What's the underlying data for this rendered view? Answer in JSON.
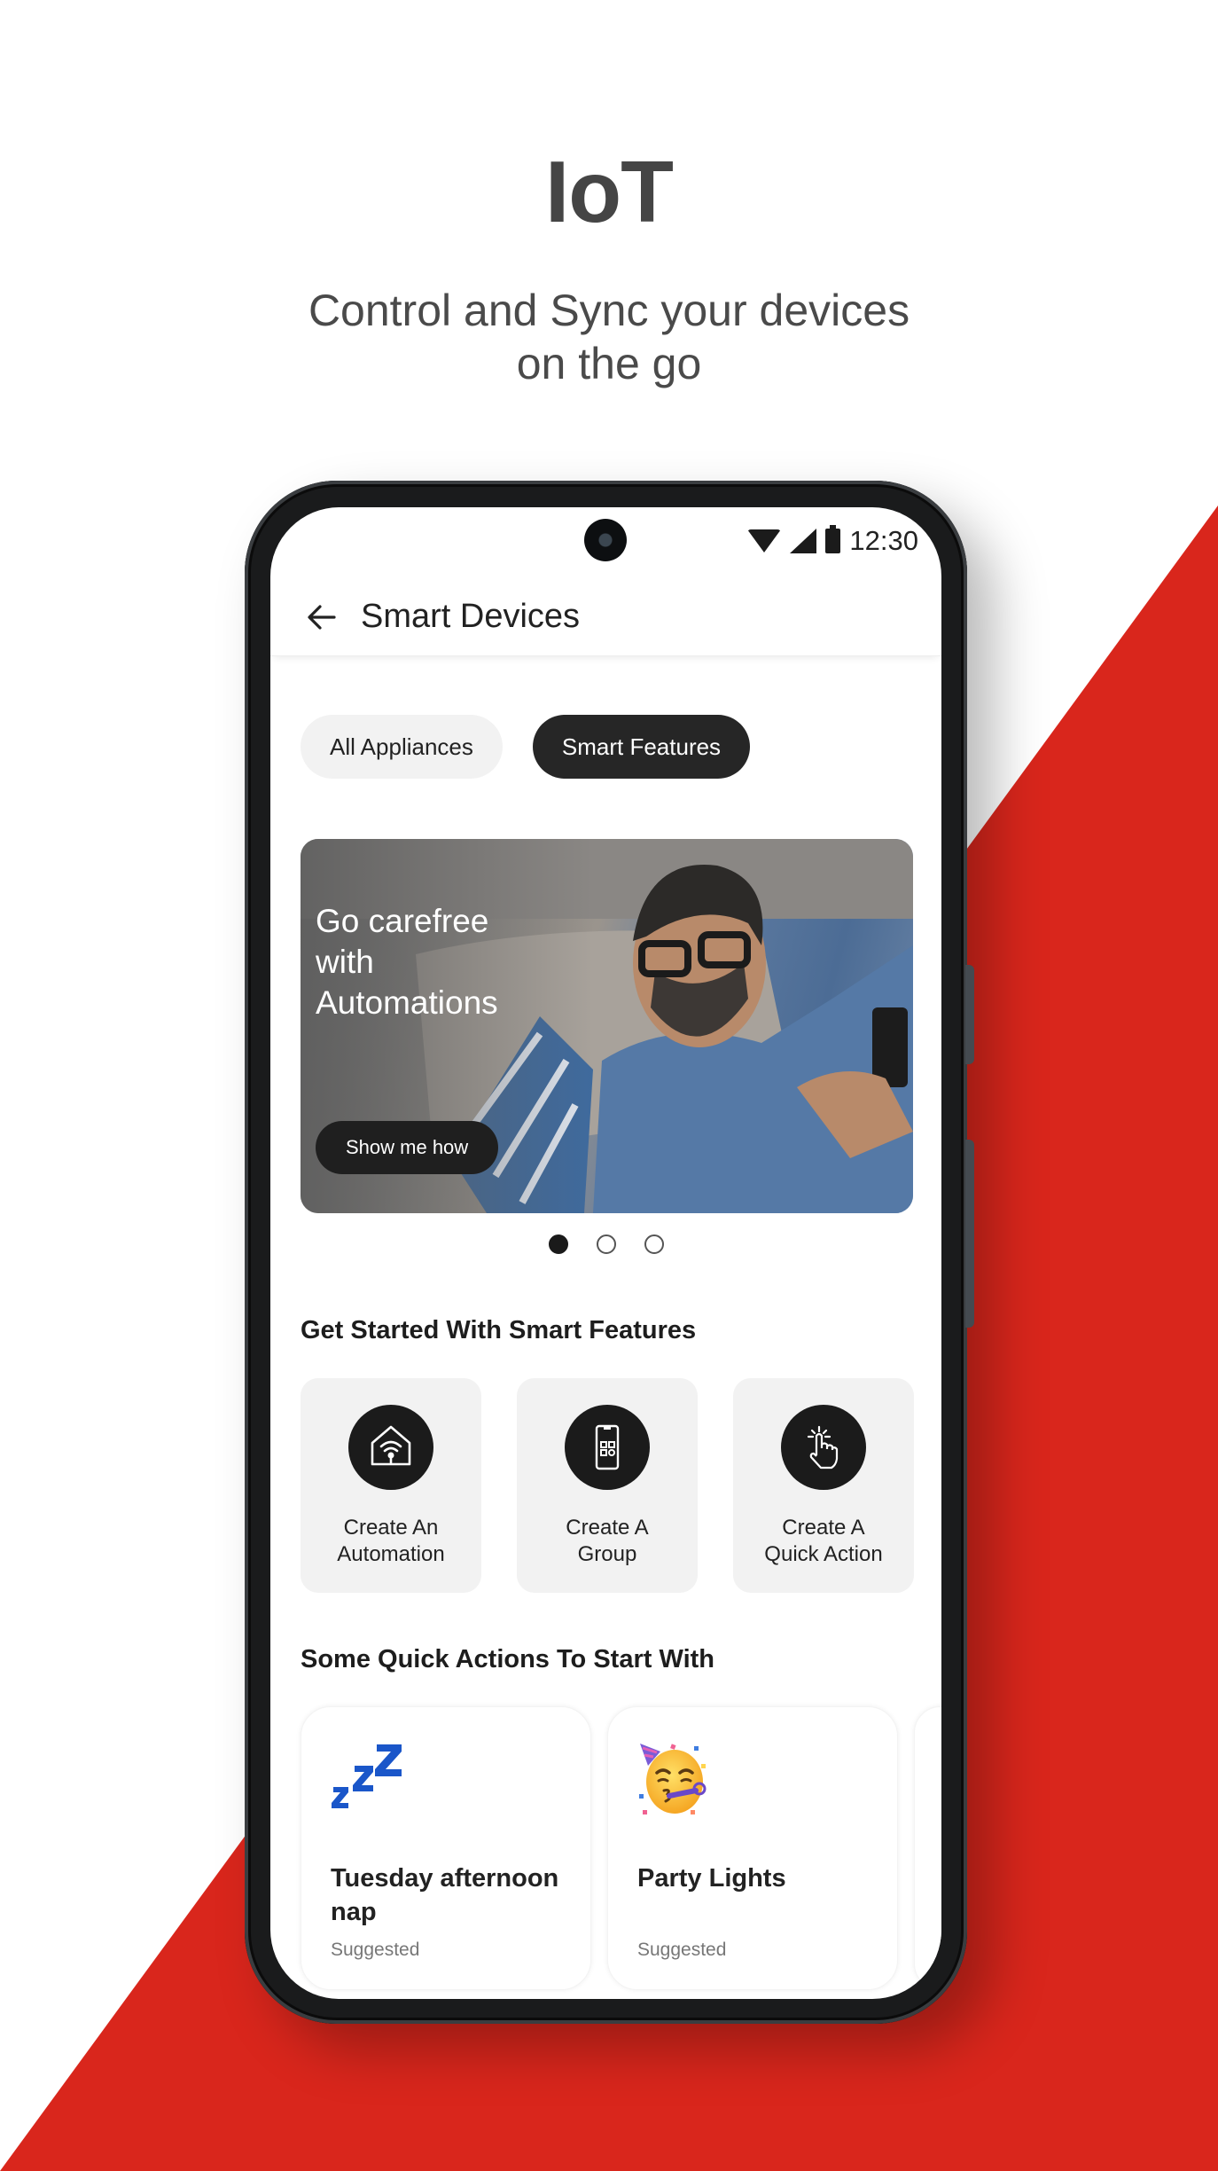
{
  "hero": {
    "title": "IoT",
    "subtitle_line1": "Control and Sync your devices",
    "subtitle_line2": "on the go"
  },
  "colors": {
    "brand_red": "#d9261c",
    "dark": "#262626",
    "chip_inactive_bg": "#f2f2f2",
    "card_bg": "#f2f2f2",
    "zzz_blue": "#1a56c9"
  },
  "status_bar": {
    "time": "12:30",
    "icons": [
      "wifi-icon",
      "signal-icon",
      "battery-icon"
    ]
  },
  "app_bar": {
    "back_icon": "arrow-left-icon",
    "title": "Smart Devices"
  },
  "tabs": [
    {
      "label": "All Appliances",
      "selected": false
    },
    {
      "label": "Smart Features",
      "selected": true
    }
  ],
  "banner": {
    "headline_line1": "Go carefree",
    "headline_line2": "with",
    "headline_line3": "Automations",
    "button_label": "Show me how",
    "page_count": 3,
    "current_page": 1
  },
  "get_started": {
    "title": "Get Started With Smart Features",
    "items": [
      {
        "icon": "smart-home-icon",
        "line1": "Create An",
        "line2": "Automation"
      },
      {
        "icon": "phone-grid-icon",
        "line1": "Create A",
        "line2": "Group"
      },
      {
        "icon": "tap-hand-icon",
        "line1": "Create A",
        "line2": "Quick Action"
      }
    ]
  },
  "quick_actions": {
    "title": "Some Quick Actions To Start With",
    "items": [
      {
        "icon": "zzz-sleep-icon",
        "title": "Tuesday afternoon nap",
        "subtitle": "Suggested"
      },
      {
        "icon": "party-face-icon",
        "title": "Party Lights",
        "subtitle": "Suggested"
      }
    ]
  }
}
